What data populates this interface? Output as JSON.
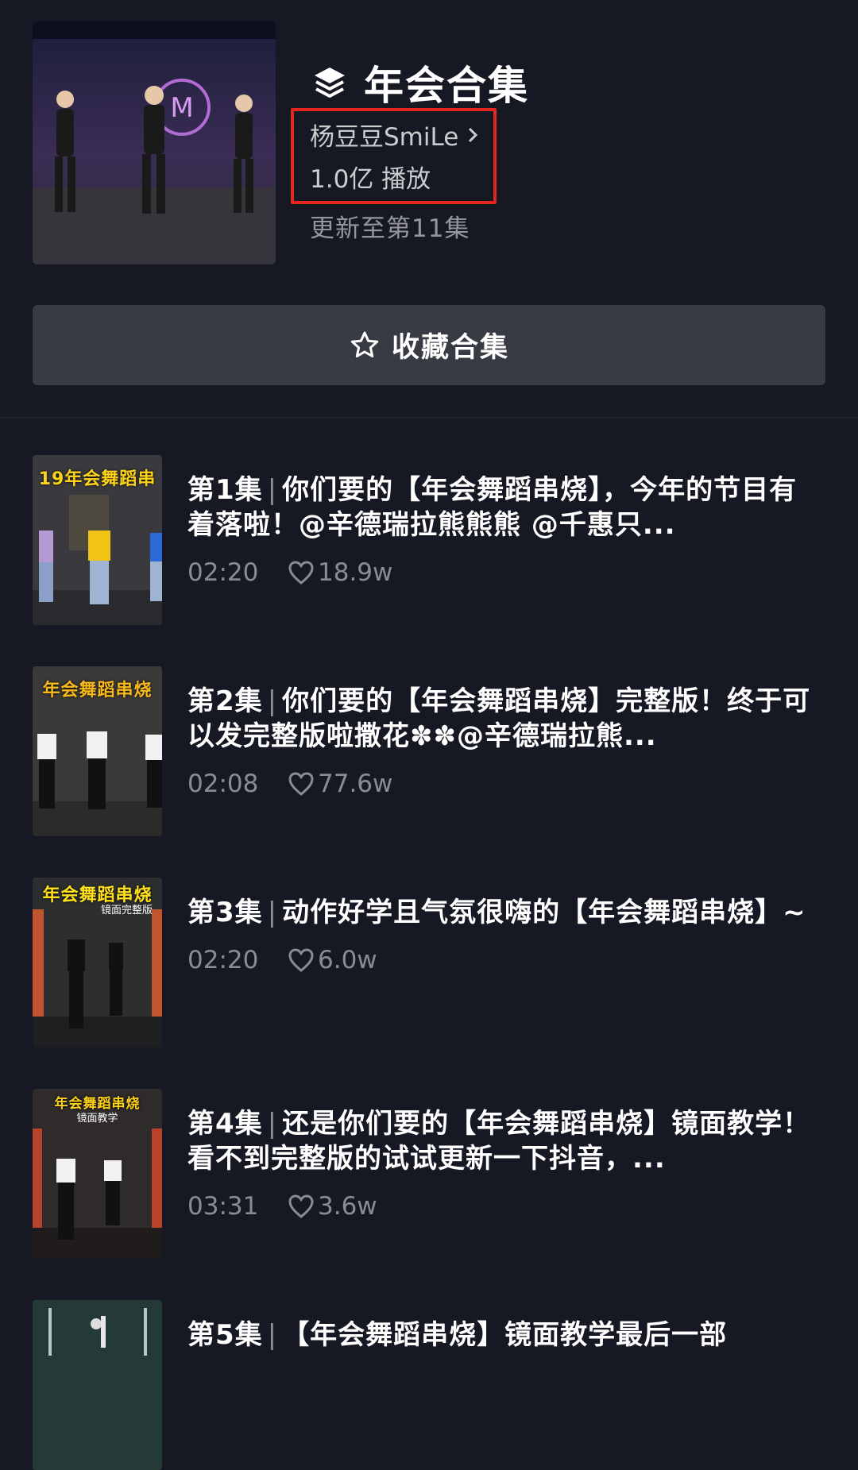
{
  "collection": {
    "title": "年会合集",
    "author": "杨豆豆SmiLe",
    "plays": "1.0亿 播放",
    "updated": "更新至第11集",
    "collect_label": "收藏合集"
  },
  "colors": {
    "background": "#161823",
    "button": "#393b44",
    "highlight": "#e3261f"
  },
  "episodes": [
    {
      "ep": "第1集",
      "sep": "|",
      "text": "你们要的【年会舞蹈串烧】，今年的节目有着落啦！@辛德瑞拉熊熊熊 @千惠只...",
      "duration": "02:20",
      "likes": "18.9w",
      "thumb_caption": "19年会舞蹈串"
    },
    {
      "ep": "第2集",
      "sep": "|",
      "text": "你们要的【年会舞蹈串烧】完整版！终于可以发完整版啦撒花✽✽@辛德瑞拉熊...",
      "duration": "02:08",
      "likes": "77.6w",
      "thumb_caption": "年会舞蹈串烧"
    },
    {
      "ep": "第3集",
      "sep": "|",
      "text": "动作好学且气氛很嗨的【年会舞蹈串烧】~",
      "duration": "02:20",
      "likes": "6.0w",
      "thumb_caption": "年会舞蹈串烧",
      "thumb_caption2": "镜面完整版"
    },
    {
      "ep": "第4集",
      "sep": "|",
      "text": "还是你们要的【年会舞蹈串烧】镜面教学！看不到完整版的试试更新一下抖音，...",
      "duration": "03:31",
      "likes": "3.6w",
      "thumb_caption": "年会舞蹈串烧",
      "thumb_caption2": "镜面教学"
    },
    {
      "ep": "第5集",
      "sep": "|",
      "text": "【年会舞蹈串烧】镜面教学最后一部",
      "duration": "",
      "likes": ""
    }
  ]
}
